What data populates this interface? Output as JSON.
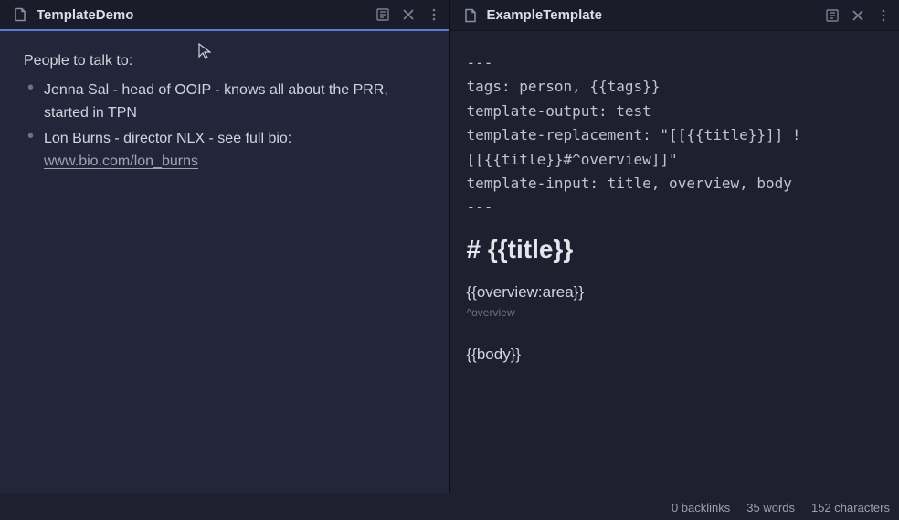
{
  "leftPane": {
    "title": "TemplateDemo",
    "heading": "People to talk to:",
    "bullets": [
      {
        "prefix": "Jenna Sal - head of OOIP - knows all about the PRR, started in TPN",
        "link": ""
      },
      {
        "prefix": "Lon Burns - director NLX - see full bio: ",
        "link": "www.bio.com/lon_burns"
      }
    ]
  },
  "rightPane": {
    "title": "ExampleTemplate",
    "frontmatter": "---\ntags: person, {{tags}}\ntemplate-output: test\ntemplate-replacement: \"[[{{title}}]] ![[{{title}}#^overview]]\"\ntemplate-input: title, overview, body\n---",
    "h1": "# {{title}}",
    "overview": "{{overview:area}}",
    "caret": "^overview",
    "body": "{{body}}"
  },
  "status": {
    "backlinks": "0 backlinks",
    "words": "35 words",
    "chars": "152 characters"
  }
}
